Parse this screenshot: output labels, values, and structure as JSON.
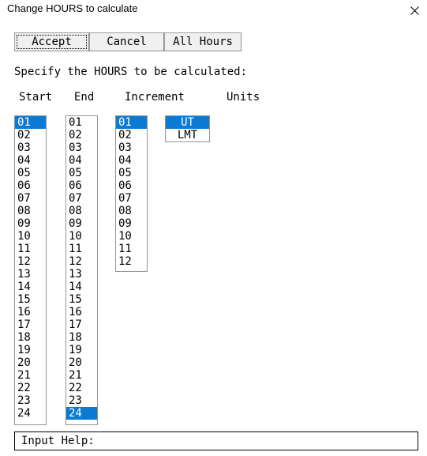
{
  "window": {
    "title": "Change HOURS to calculate",
    "close_icon": "close-icon"
  },
  "toolbar": {
    "accept_label": "Accept",
    "cancel_label": "Cancel",
    "all_hours_label": "All Hours"
  },
  "main": {
    "instruction": "Specify the HOURS to be calculated:",
    "columns": {
      "start_header": "Start",
      "end_header": "End",
      "increment_header": "Increment",
      "units_header": "Units"
    },
    "start_list": {
      "options": [
        "01",
        "02",
        "03",
        "04",
        "05",
        "06",
        "07",
        "08",
        "09",
        "10",
        "11",
        "12",
        "13",
        "14",
        "15",
        "16",
        "17",
        "18",
        "19",
        "20",
        "21",
        "22",
        "23",
        "24"
      ],
      "selected": "01"
    },
    "end_list": {
      "options": [
        "01",
        "02",
        "03",
        "04",
        "05",
        "06",
        "07",
        "08",
        "09",
        "10",
        "11",
        "12",
        "13",
        "14",
        "15",
        "16",
        "17",
        "18",
        "19",
        "20",
        "21",
        "22",
        "23",
        "24"
      ],
      "selected": "24"
    },
    "increment_list": {
      "options": [
        "01",
        "02",
        "03",
        "04",
        "05",
        "06",
        "07",
        "08",
        "09",
        "10",
        "11",
        "12"
      ],
      "selected": "01"
    },
    "units_list": {
      "options": [
        "UT",
        "LMT"
      ],
      "selected": "UT"
    }
  },
  "status": {
    "input_help_label": "Input Help:"
  },
  "colors": {
    "selection_blue": "#0b7ad4",
    "button_face": "#f0f0f0",
    "border_gray": "#949494",
    "background": "#ffffff"
  }
}
